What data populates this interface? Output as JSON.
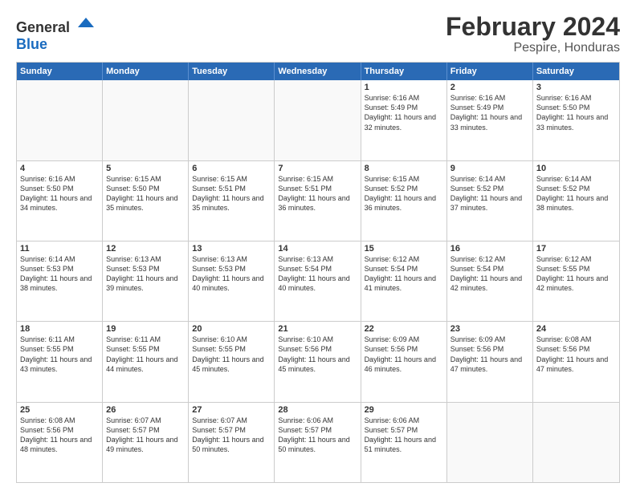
{
  "logo": {
    "general": "General",
    "blue": "Blue"
  },
  "title": "February 2024",
  "subtitle": "Pespire, Honduras",
  "days_of_week": [
    "Sunday",
    "Monday",
    "Tuesday",
    "Wednesday",
    "Thursday",
    "Friday",
    "Saturday"
  ],
  "weeks": [
    [
      {
        "day": "",
        "info": ""
      },
      {
        "day": "",
        "info": ""
      },
      {
        "day": "",
        "info": ""
      },
      {
        "day": "",
        "info": ""
      },
      {
        "day": "1",
        "info": "Sunrise: 6:16 AM\nSunset: 5:49 PM\nDaylight: 11 hours and 32 minutes."
      },
      {
        "day": "2",
        "info": "Sunrise: 6:16 AM\nSunset: 5:49 PM\nDaylight: 11 hours and 33 minutes."
      },
      {
        "day": "3",
        "info": "Sunrise: 6:16 AM\nSunset: 5:50 PM\nDaylight: 11 hours and 33 minutes."
      }
    ],
    [
      {
        "day": "4",
        "info": "Sunrise: 6:16 AM\nSunset: 5:50 PM\nDaylight: 11 hours and 34 minutes."
      },
      {
        "day": "5",
        "info": "Sunrise: 6:15 AM\nSunset: 5:50 PM\nDaylight: 11 hours and 35 minutes."
      },
      {
        "day": "6",
        "info": "Sunrise: 6:15 AM\nSunset: 5:51 PM\nDaylight: 11 hours and 35 minutes."
      },
      {
        "day": "7",
        "info": "Sunrise: 6:15 AM\nSunset: 5:51 PM\nDaylight: 11 hours and 36 minutes."
      },
      {
        "day": "8",
        "info": "Sunrise: 6:15 AM\nSunset: 5:52 PM\nDaylight: 11 hours and 36 minutes."
      },
      {
        "day": "9",
        "info": "Sunrise: 6:14 AM\nSunset: 5:52 PM\nDaylight: 11 hours and 37 minutes."
      },
      {
        "day": "10",
        "info": "Sunrise: 6:14 AM\nSunset: 5:52 PM\nDaylight: 11 hours and 38 minutes."
      }
    ],
    [
      {
        "day": "11",
        "info": "Sunrise: 6:14 AM\nSunset: 5:53 PM\nDaylight: 11 hours and 38 minutes."
      },
      {
        "day": "12",
        "info": "Sunrise: 6:13 AM\nSunset: 5:53 PM\nDaylight: 11 hours and 39 minutes."
      },
      {
        "day": "13",
        "info": "Sunrise: 6:13 AM\nSunset: 5:53 PM\nDaylight: 11 hours and 40 minutes."
      },
      {
        "day": "14",
        "info": "Sunrise: 6:13 AM\nSunset: 5:54 PM\nDaylight: 11 hours and 40 minutes."
      },
      {
        "day": "15",
        "info": "Sunrise: 6:12 AM\nSunset: 5:54 PM\nDaylight: 11 hours and 41 minutes."
      },
      {
        "day": "16",
        "info": "Sunrise: 6:12 AM\nSunset: 5:54 PM\nDaylight: 11 hours and 42 minutes."
      },
      {
        "day": "17",
        "info": "Sunrise: 6:12 AM\nSunset: 5:55 PM\nDaylight: 11 hours and 42 minutes."
      }
    ],
    [
      {
        "day": "18",
        "info": "Sunrise: 6:11 AM\nSunset: 5:55 PM\nDaylight: 11 hours and 43 minutes."
      },
      {
        "day": "19",
        "info": "Sunrise: 6:11 AM\nSunset: 5:55 PM\nDaylight: 11 hours and 44 minutes."
      },
      {
        "day": "20",
        "info": "Sunrise: 6:10 AM\nSunset: 5:55 PM\nDaylight: 11 hours and 45 minutes."
      },
      {
        "day": "21",
        "info": "Sunrise: 6:10 AM\nSunset: 5:56 PM\nDaylight: 11 hours and 45 minutes."
      },
      {
        "day": "22",
        "info": "Sunrise: 6:09 AM\nSunset: 5:56 PM\nDaylight: 11 hours and 46 minutes."
      },
      {
        "day": "23",
        "info": "Sunrise: 6:09 AM\nSunset: 5:56 PM\nDaylight: 11 hours and 47 minutes."
      },
      {
        "day": "24",
        "info": "Sunrise: 6:08 AM\nSunset: 5:56 PM\nDaylight: 11 hours and 47 minutes."
      }
    ],
    [
      {
        "day": "25",
        "info": "Sunrise: 6:08 AM\nSunset: 5:56 PM\nDaylight: 11 hours and 48 minutes."
      },
      {
        "day": "26",
        "info": "Sunrise: 6:07 AM\nSunset: 5:57 PM\nDaylight: 11 hours and 49 minutes."
      },
      {
        "day": "27",
        "info": "Sunrise: 6:07 AM\nSunset: 5:57 PM\nDaylight: 11 hours and 50 minutes."
      },
      {
        "day": "28",
        "info": "Sunrise: 6:06 AM\nSunset: 5:57 PM\nDaylight: 11 hours and 50 minutes."
      },
      {
        "day": "29",
        "info": "Sunrise: 6:06 AM\nSunset: 5:57 PM\nDaylight: 11 hours and 51 minutes."
      },
      {
        "day": "",
        "info": ""
      },
      {
        "day": "",
        "info": ""
      }
    ]
  ]
}
